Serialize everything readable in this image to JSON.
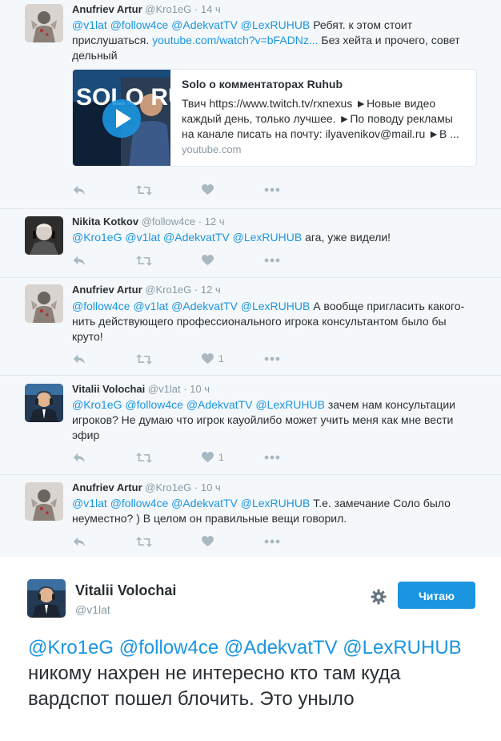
{
  "thread": {
    "tweets": [
      {
        "name": "Anufriev Artur",
        "handle": "@Kro1eG",
        "time": "14 ч",
        "mentions": [
          "@v1lat",
          "@follow4ce",
          "@AdekvatTV",
          "@LexRUHUB"
        ],
        "text": "Ребят. к этом стоит прислушаться.",
        "link": "youtube.com/watch?v=bFADNz...",
        "text_after": "Без хейта и прочего, совет дельный",
        "card": {
          "title": "Solo о комментаторах Ruhub",
          "description": "Твич https://www.twitch.tv/rxnexus ►Новые видео каждый день, только лучшее. ►По поводу рекламы на канале писать на почту: ilyavenikov@mail.ru ►В ...",
          "domain": "youtube.com",
          "thumb_text": "SOLO RUHUB"
        },
        "likes": ""
      },
      {
        "name": "Nikita Kotkov",
        "handle": "@follow4ce",
        "time": "12 ч",
        "mentions": [
          "@Kro1eG",
          "@v1lat",
          "@AdekvatTV",
          "@LexRUHUB"
        ],
        "text": "ага, уже видели!",
        "likes": ""
      },
      {
        "name": "Anufriev Artur",
        "handle": "@Kro1eG",
        "time": "12 ч",
        "mentions": [
          "@follow4ce",
          "@v1lat",
          "@AdekvatTV",
          "@LexRUHUB"
        ],
        "text": "А вообще пригласить какого-нить действующего профессионального игрока консультантом было бы круто!",
        "likes": "1"
      },
      {
        "name": "Vitalii Volochai",
        "handle": "@v1lat",
        "time": "10 ч",
        "mentions": [
          "@Kro1eG",
          "@follow4ce",
          "@AdekvatTV",
          "@LexRUHUB"
        ],
        "text": "зачем нам консультации игроков? Не думаю что игрок кауойлибо может учить меня как мне вести эфир",
        "likes": "1"
      },
      {
        "name": "Anufriev Artur",
        "handle": "@Kro1eG",
        "time": "10 ч",
        "mentions": [
          "@v1lat",
          "@follow4ce",
          "@AdekvatTV",
          "@LexRUHUB"
        ],
        "text": "Т.е. замечание Соло было неуместно? ) В целом он правильные вещи говорил.",
        "likes": ""
      }
    ]
  },
  "main": {
    "name": "Vitalii Volochai",
    "handle": "@v1lat",
    "follow_label": "Читаю",
    "mentions": [
      "@Kro1eG",
      "@follow4ce",
      "@AdekvatTV",
      "@LexRUHUB"
    ],
    "text": "никому нахрен не интересно кто там куда вардспот пошел блочить. Это уныло"
  },
  "separator": "·",
  "icons": {
    "reply": "reply-icon",
    "retweet": "retweet-icon",
    "like": "heart-icon",
    "more": "more-icon",
    "settings": "gear-icon"
  },
  "colors": {
    "link": "#1b95e0",
    "button": "#1b95e0",
    "muted": "#8899a6",
    "action": "#aab8c2",
    "thread_bg": "#f5f8fa"
  }
}
